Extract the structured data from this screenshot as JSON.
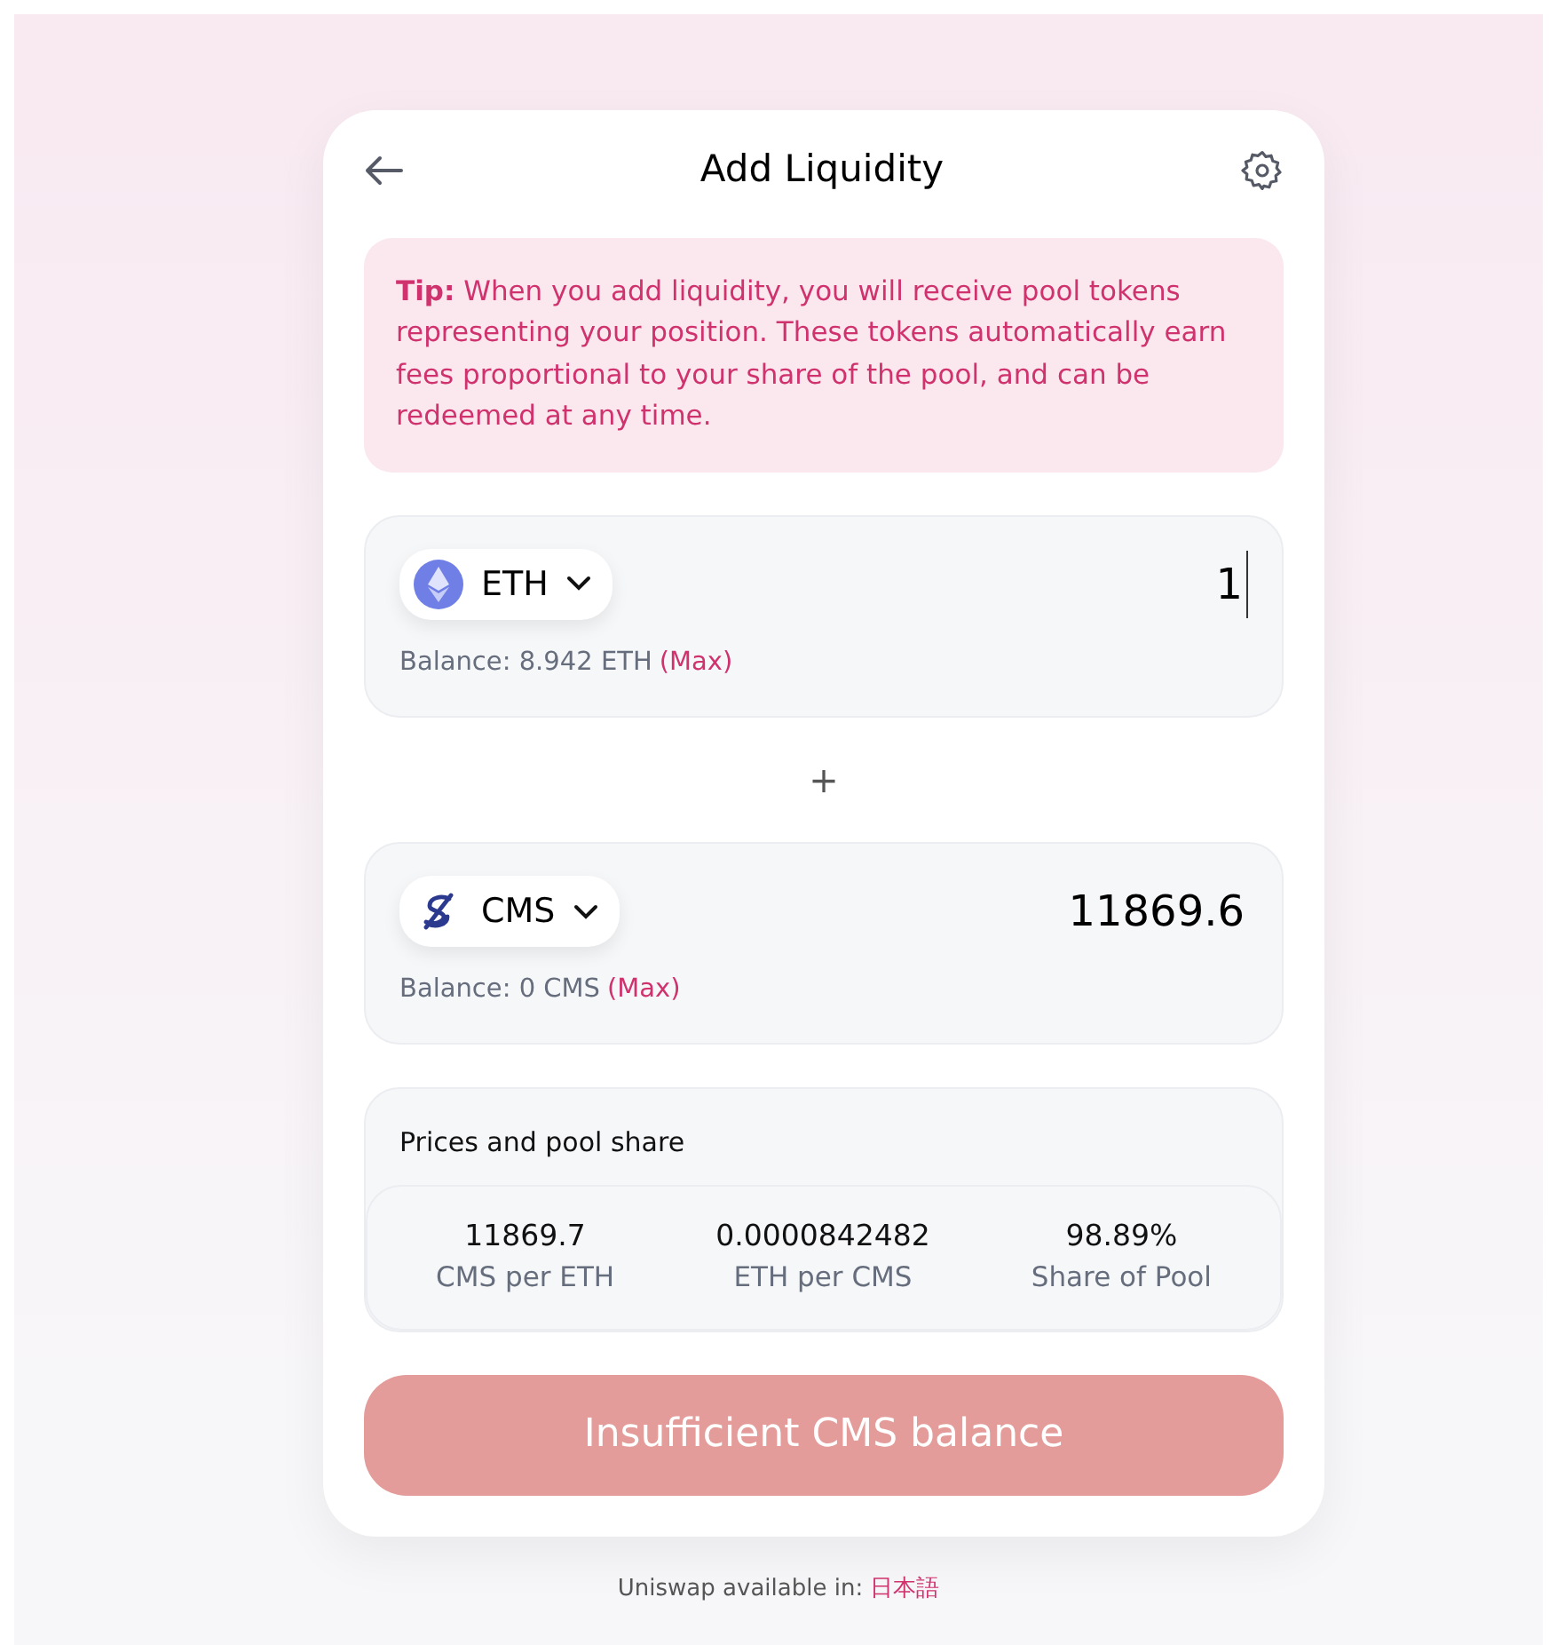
{
  "header": {
    "title": "Add Liquidity"
  },
  "tip": "**Tip:** When you add liquidity, you will receive pool tokens representing your position. These tokens automatically earn fees proportional to your share of the pool, and can be redeemed at any time.",
  "inputs": [
    {
      "token": "ETH",
      "kind": "eth",
      "value": "1",
      "focused": true,
      "balance": "Balance: 8.942 ETH",
      "max": "(Max)"
    },
    {
      "token": "CMS",
      "kind": "cms",
      "value": "11869.6",
      "focused": false,
      "balance": "Balance: 0 CMS",
      "max": "(Max)"
    }
  ],
  "separator": "+",
  "prices": {
    "title": "Prices and pool share",
    "items": [
      {
        "value": "11869.7",
        "label": "CMS per ETH"
      },
      {
        "value": "0.0000842482",
        "label": "ETH per CMS"
      },
      {
        "value": "98.89%",
        "label": "Share of Pool"
      }
    ]
  },
  "submit": {
    "label": "Insufficient CMS balance",
    "disabled": true
  },
  "footer": {
    "text": "Uniswap available in:",
    "link": "日本語"
  }
}
